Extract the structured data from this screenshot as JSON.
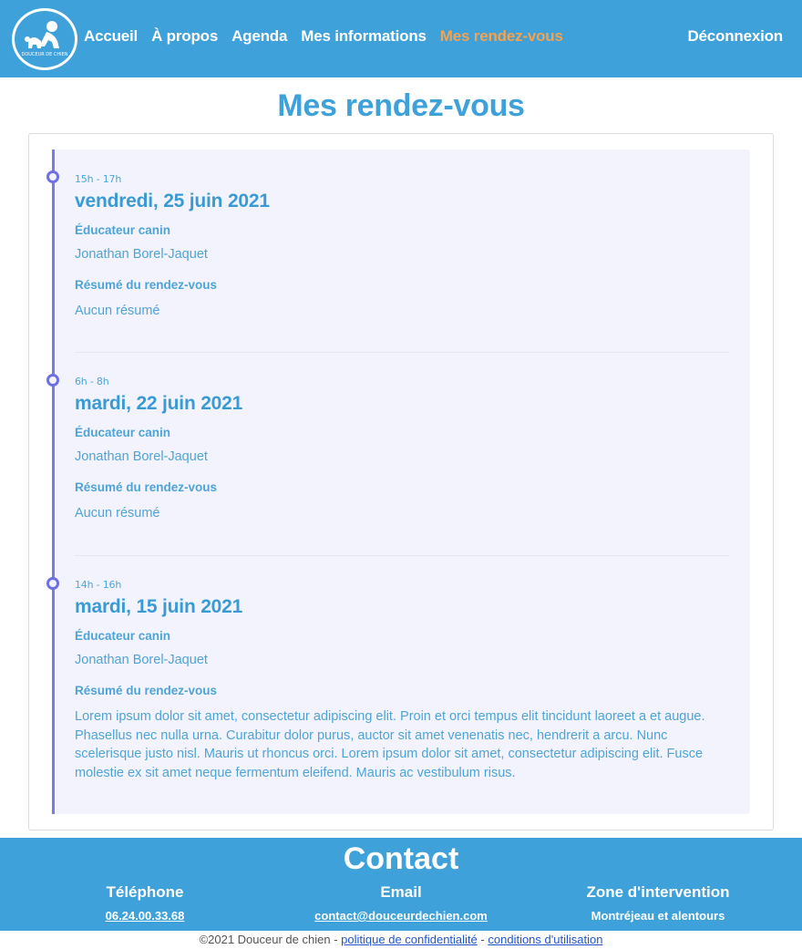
{
  "navbar": {
    "logo_text": "DOUCEUR DE CHIEN",
    "links": [
      {
        "label": "Accueil"
      },
      {
        "label": "À propos"
      },
      {
        "label": "Agenda"
      },
      {
        "label": "Mes informations"
      },
      {
        "label": "Mes rendez-vous",
        "active": true
      }
    ],
    "logout_label": "Déconnexion"
  },
  "page": {
    "title": "Mes rendez-vous"
  },
  "appointments": [
    {
      "time": "15h - 17h",
      "date": "vendredi, 25 juin 2021",
      "educator_label": "Éducateur canin",
      "educator": "Jonathan Borel-Jaquet",
      "summary_label": "Résumé du rendez-vous",
      "summary": "Aucun résumé"
    },
    {
      "time": "6h - 8h",
      "date": "mardi, 22 juin 2021",
      "educator_label": "Éducateur canin",
      "educator": "Jonathan Borel-Jaquet",
      "summary_label": "Résumé du rendez-vous",
      "summary": "Aucun résumé"
    },
    {
      "time": "14h - 16h",
      "date": "mardi, 15 juin 2021",
      "educator_label": "Éducateur canin",
      "educator": "Jonathan Borel-Jaquet",
      "summary_label": "Résumé du rendez-vous",
      "summary": "Lorem ipsum dolor sit amet, consectetur adipiscing elit. Proin et orci tempus elit tincidunt laoreet a et augue. Phasellus nec nulla urna. Curabitur dolor purus, auctor sit amet venenatis nec, hendrerit a arcu. Nunc scelerisque justo nisl. Mauris ut rhoncus orci. Lorem ipsum dolor sit amet, consectetur adipiscing elit. Fusce molestie ex sit amet neque fermentum eleifend. Mauris ac vestibulum risus."
    }
  ],
  "footer": {
    "title": "Contact",
    "phone_label": "Téléphone",
    "phone": "06.24.00.33.68",
    "email_label": "Email",
    "email": "contact@douceurdechien.com",
    "zone_label": "Zone d'intervention",
    "zone": "Montréjeau et alentours"
  },
  "copyright": {
    "text": "©2021 Douceur de chien",
    "sep": "-",
    "privacy": "politique de confidentialité",
    "terms": "conditions d'utilisation"
  },
  "colors": {
    "primary": "#3ea1da",
    "active_nav": "#f6a24d",
    "timeline": "#7b7bec",
    "timeline_bg": "#f3f3fd"
  }
}
